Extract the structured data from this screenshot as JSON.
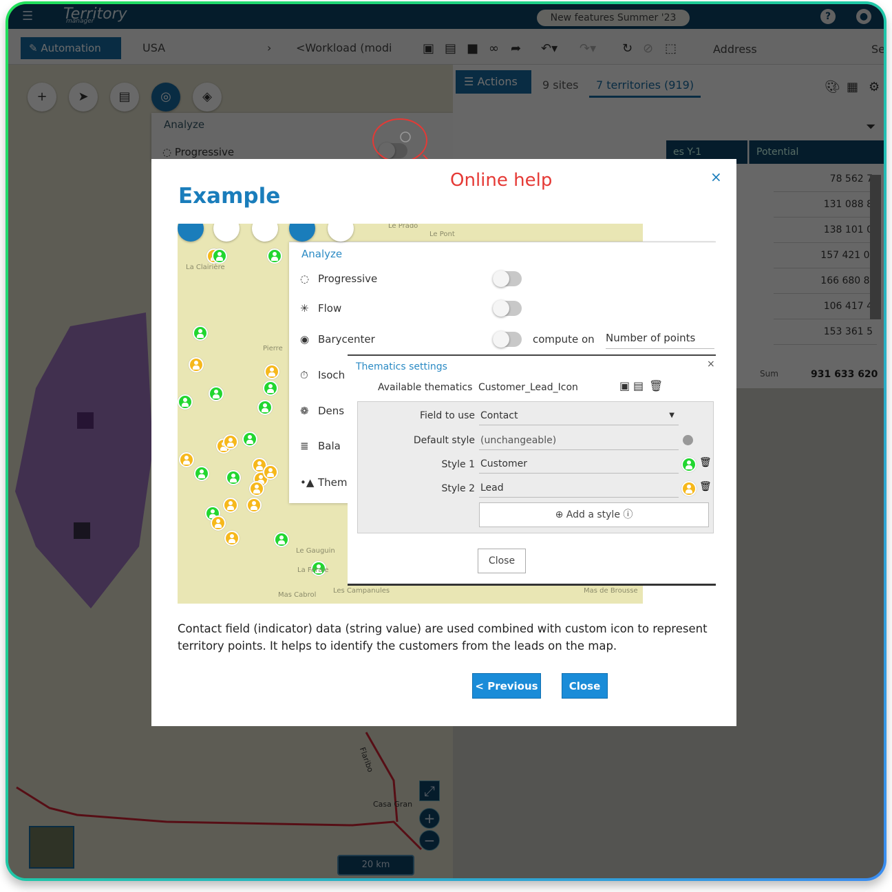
{
  "app": {
    "logo": "Territory",
    "logo_sub": "manager",
    "news_pill": "New features Summer '23"
  },
  "toolbar": {
    "automation": "Automation",
    "country": "USA",
    "chevron": "›",
    "workload": "<Workload (modi",
    "address": "Address",
    "search_stub": "Se"
  },
  "map_tools": {
    "analyze_title": "Analyze",
    "progressive": "Progressive"
  },
  "right_panel": {
    "actions": "Actions",
    "sites_tab": "9 sites",
    "territories_tab": "7 territories (919)",
    "columns": [
      "es Y-1",
      "Potential"
    ],
    "potential_values": [
      "78 562 7",
      "131 088 8",
      "138 101 0",
      "157 421 0.",
      "166 680 8.",
      "106 417 4",
      "153 361 5"
    ],
    "sum_label": "Sum",
    "sum_value": "931 633 620"
  },
  "map_bottom": {
    "scale": "20 km",
    "place": "Casa Gran",
    "road": "Flaribo"
  },
  "annotation": {
    "text": "Online help",
    "color": "#e53935"
  },
  "modal": {
    "title": "Example",
    "close_x": "×",
    "description": "Contact field (indicator) data (string value) are used combined with custom icon to represent territory points. It helps to identify the customers from the leads on the map.",
    "previous": "< Previous",
    "close": "Close",
    "accent": "#1a8cd8",
    "screenshot": {
      "map_labels": [
        "La Clairière",
        "Pierre",
        "Le Gauguin",
        "La Feraie",
        "Mas Cabrol",
        "Les Campanules",
        "Le Pont",
        "Le Prado",
        "Mas de Brousse"
      ],
      "analyze_title": "Analyze",
      "rows": [
        {
          "label": "Progressive",
          "icon": "progressive-icon"
        },
        {
          "label": "Flow",
          "icon": "flow-icon"
        },
        {
          "label": "Barycenter",
          "icon": "barycenter-icon"
        },
        {
          "label": "Isoch",
          "icon": "timer-icon"
        },
        {
          "label": "Dens",
          "icon": "density-icon"
        },
        {
          "label": "Bala",
          "icon": "balance-icon"
        },
        {
          "label": "Them",
          "icon": "thematics-icon"
        }
      ],
      "compute_on_label": "compute on",
      "compute_on_value": "Number of points",
      "thematics": {
        "title": "Thematics settings",
        "available_label": "Available thematics",
        "available_value": "Customer_Lead_Icon",
        "field_label": "Field to use",
        "field_value": "Contact",
        "default_label": "Default style",
        "default_value": "(unchangeable)",
        "style1_label": "Style 1",
        "style1_value": "Customer",
        "style1_color": "#22d630",
        "style2_label": "Style 2",
        "style2_value": "Lead",
        "style2_color": "#f6b81c",
        "add_style": "Add a style",
        "close": "Close"
      }
    }
  }
}
